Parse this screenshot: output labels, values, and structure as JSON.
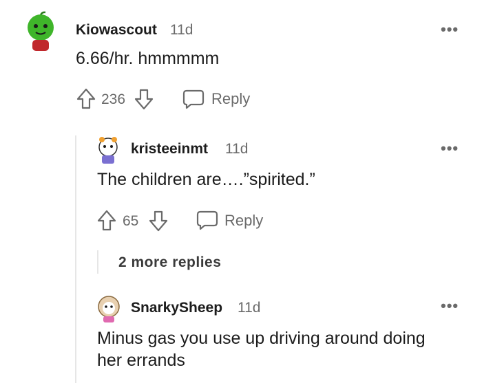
{
  "comments": [
    {
      "username": "Kiowascout",
      "time": "11d",
      "body": "6.66/hr. hmmmmm",
      "votes": "236",
      "reply_label": "Reply",
      "more_label": "•••"
    },
    {
      "username": "kristeeinmt",
      "time": "11d",
      "body": "The children are….”spirited.”",
      "votes": "65",
      "reply_label": "Reply",
      "more_label": "•••"
    },
    {
      "username": "SnarkySheep",
      "time": "11d",
      "body_line1": "Minus gas you use up driving around doing",
      "body_line2": "her errands",
      "more_label": "•••"
    }
  ],
  "more_replies": "2 more replies"
}
